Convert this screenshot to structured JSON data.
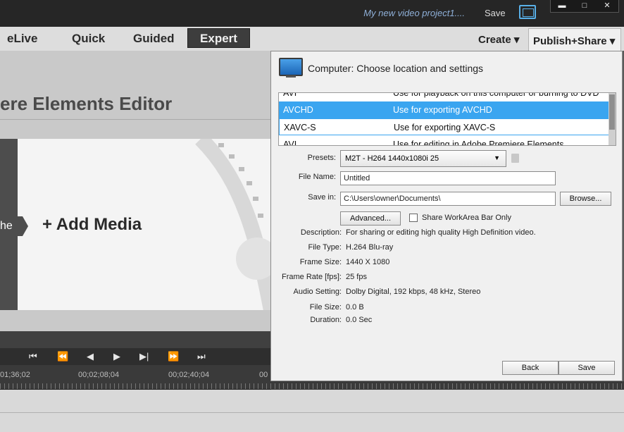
{
  "titlebar": {
    "project_title": "My new video project1....",
    "save_label": "Save",
    "minimize": "▬",
    "maximize": "□",
    "close": "✕"
  },
  "modes": {
    "elive": "eLive",
    "quick": "Quick",
    "guided": "Guided",
    "expert": "Expert"
  },
  "menus": {
    "create": "Create ▾",
    "publish": "Publish+Share ▾"
  },
  "editor": {
    "title": "ere Elements Editor",
    "tab_label": "he",
    "add_media": "+  Add Media"
  },
  "transport": {
    "buttons": [
      "⏮",
      "⏪",
      "◀",
      "▶",
      "▶|",
      "⏩",
      "⏭"
    ]
  },
  "timeline": {
    "ticks": [
      "01;36;02",
      "00;02;08;04",
      "00;02;40;04",
      "00"
    ]
  },
  "dialog": {
    "heading": "Computer: Choose location and settings",
    "formats": [
      {
        "name": "AVI",
        "desc": "Use for playback on this computer or burning to DVD"
      },
      {
        "name": "AVCHD",
        "desc": "Use for exporting AVCHD"
      },
      {
        "name": "XAVC-S",
        "desc": "Use for exporting XAVC-S"
      },
      {
        "name": "AVI",
        "desc": "Use for editing in Adobe Premiere Elements"
      }
    ],
    "presets_label": "Presets:",
    "presets_value": "M2T - H264 1440x1080i 25",
    "file_name_label": "File Name:",
    "file_name_value": "Untitled",
    "save_in_label": "Save in:",
    "save_in_value": "C:\\Users\\owner\\Documents\\",
    "browse_label": "Browse...",
    "advanced_label": "Advanced...",
    "share_workarea_label": "Share WorkArea Bar Only",
    "description_label": "Description:",
    "description_value": "For sharing or editing high quality High Definition video.",
    "file_type_label": "File Type:",
    "file_type_value": "H.264 Blu-ray",
    "frame_size_label": "Frame Size:",
    "frame_size_value": "1440 X 1080",
    "frame_rate_label": "Frame Rate [fps]:",
    "frame_rate_value": "25 fps",
    "audio_label": "Audio Setting:",
    "audio_value": "Dolby Digital, 192 kbps, 48 kHz, Stereo",
    "file_size_label": "File Size:",
    "file_size_value": "0.0 B",
    "duration_label": "Duration:",
    "duration_value": "0.0 Sec",
    "back_label": "Back",
    "save_label": "Save"
  },
  "colors": {
    "selected_row": "#3aa5f0",
    "accent": "#59b0e8"
  }
}
